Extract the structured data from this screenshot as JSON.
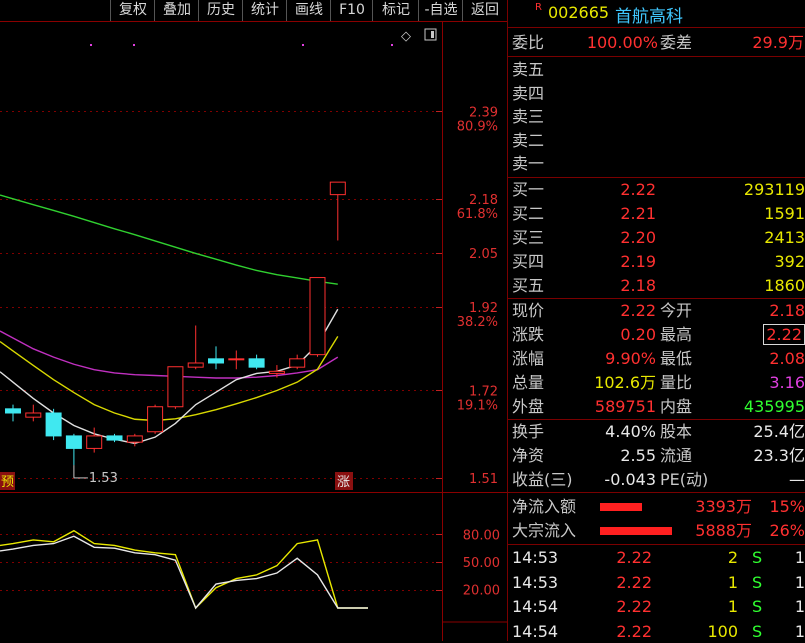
{
  "toolbar": {
    "buttons": [
      "复权",
      "叠加",
      "历史",
      "统计",
      "画线",
      "F10",
      "标记",
      "-自选",
      "返回"
    ]
  },
  "stock": {
    "badge": "R",
    "code": "002665",
    "name": "首航高科"
  },
  "chart_data": {
    "type": "candlestick",
    "y_ticks": [
      {
        "price": "2.39",
        "pct": "80.9%"
      },
      {
        "price": "2.18",
        "pct": "61.8%"
      },
      {
        "price": "2.05",
        "pct": ""
      },
      {
        "price": "1.92",
        "pct": "38.2%"
      },
      {
        "price": "1.72",
        "pct": "19.1%"
      },
      {
        "price": "1.51",
        "pct": ""
      }
    ],
    "low_annotation": "1.53",
    "badge_left": "预",
    "badge_right": "涨",
    "candles": [
      {
        "open": 1.676,
        "close": 1.666,
        "high": 1.686,
        "low": 1.646
      },
      {
        "open": 1.656,
        "close": 1.666,
        "high": 1.686,
        "low": 1.646
      },
      {
        "open": 1.666,
        "close": 1.611,
        "high": 1.676,
        "low": 1.601
      },
      {
        "open": 1.611,
        "close": 1.581,
        "high": 1.616,
        "low": 1.541
      },
      {
        "open": 1.581,
        "close": 1.611,
        "high": 1.631,
        "low": 1.571
      },
      {
        "open": 1.611,
        "close": 1.601,
        "high": 1.616,
        "low": 1.596
      },
      {
        "open": 1.596,
        "close": 1.611,
        "high": 1.616,
        "low": 1.586
      },
      {
        "open": 1.621,
        "close": 1.681,
        "high": 1.686,
        "low": 1.616
      },
      {
        "open": 1.681,
        "close": 1.777,
        "high": 1.777,
        "low": 1.676
      },
      {
        "open": 1.776,
        "close": 1.786,
        "high": 1.876,
        "low": 1.771
      },
      {
        "open": 1.796,
        "close": 1.786,
        "high": 1.826,
        "low": 1.771
      },
      {
        "open": 1.796,
        "close": 1.796,
        "high": 1.816,
        "low": 1.771
      },
      {
        "open": 1.796,
        "close": 1.776,
        "high": 1.806,
        "low": 1.771
      },
      {
        "open": 1.761,
        "close": 1.766,
        "high": 1.781,
        "low": 1.751
      },
      {
        "open": 1.776,
        "close": 1.796,
        "high": 1.806,
        "low": 1.771
      },
      {
        "open": 1.806,
        "close": 1.991,
        "high": 1.991,
        "low": 1.801
      },
      {
        "open": 2.19,
        "close": 2.22,
        "high": 2.22,
        "low": 2.08
      }
    ],
    "ma_green": [
      2.18,
      2.166,
      2.152,
      2.138,
      2.123,
      2.108,
      2.094,
      2.079,
      2.064,
      2.049,
      2.035,
      2.021,
      2.008,
      1.998,
      1.99,
      1.982,
      1.975
    ],
    "ma_white": [
      1.74,
      1.701,
      1.666,
      1.636,
      1.616,
      1.603,
      1.593,
      1.608,
      1.641,
      1.686,
      1.716,
      1.746,
      1.761,
      1.766,
      1.781,
      1.83,
      1.915
    ],
    "ma_yellow": [
      1.815,
      1.78,
      1.746,
      1.715,
      1.686,
      1.666,
      1.651,
      1.648,
      1.652,
      1.662,
      1.674,
      1.688,
      1.703,
      1.72,
      1.74,
      1.771,
      1.85
    ],
    "ma_magenta": [
      1.846,
      1.82,
      1.8,
      1.783,
      1.77,
      1.762,
      1.758,
      1.756,
      1.754,
      1.752,
      1.75,
      1.75,
      1.752,
      1.756,
      1.762,
      1.77,
      1.8
    ],
    "indicator": {
      "y_ticks": [
        "80.00",
        "50.00",
        "20.00"
      ],
      "ylim": [
        0,
        100
      ],
      "white": [
        64,
        68,
        70,
        78,
        66,
        65,
        60,
        58,
        52,
        0,
        26,
        30,
        32,
        38,
        54,
        36,
        0
      ],
      "yellow": [
        70,
        74,
        72,
        84,
        70,
        68,
        63,
        60,
        58,
        0,
        22,
        32,
        36,
        46,
        70,
        74,
        0
      ]
    }
  },
  "order_book": {
    "weibi_label": "委比",
    "weibi_value": "100.00%",
    "weicha_label": "委差",
    "weicha_value": "29.9万",
    "asks": [
      {
        "label": "卖五"
      },
      {
        "label": "卖四"
      },
      {
        "label": "卖三"
      },
      {
        "label": "卖二"
      },
      {
        "label": "卖一"
      }
    ],
    "bids": [
      {
        "label": "买一",
        "price": "2.22",
        "vol": "293119"
      },
      {
        "label": "买二",
        "price": "2.21",
        "vol": "1591"
      },
      {
        "label": "买三",
        "price": "2.20",
        "vol": "2413"
      },
      {
        "label": "买四",
        "price": "2.19",
        "vol": "392"
      },
      {
        "label": "买五",
        "price": "2.18",
        "vol": "1860"
      }
    ]
  },
  "quote": {
    "rows": [
      {
        "l1": "现价",
        "v1": "2.22",
        "l2": "今开",
        "v2": "2.18",
        "c1": "red",
        "c2": "red"
      },
      {
        "l1": "涨跌",
        "v1": "0.20",
        "l2": "最高",
        "v2": "2.22",
        "c1": "red",
        "c2": "red"
      },
      {
        "l1": "涨幅",
        "v1": "9.90%",
        "l2": "最低",
        "v2": "2.08",
        "c1": "red",
        "c2": "red"
      },
      {
        "l1": "总量",
        "v1": "102.6万",
        "l2": "量比",
        "v2": "3.16",
        "c1": "yel",
        "c2": "mag"
      },
      {
        "l1": "外盘",
        "v1": "589751",
        "l2": "内盘",
        "v2": "435995",
        "c1": "red",
        "c2": "grn"
      }
    ]
  },
  "fundamentals": {
    "rows": [
      {
        "l1": "换手",
        "v1": "4.40%",
        "l2": "股本",
        "v2": "25.4亿"
      },
      {
        "l1": "净资",
        "v1": "2.55",
        "l2": "流通",
        "v2": "23.3亿"
      },
      {
        "l1": "收益(三)",
        "v1": "-0.043",
        "l2": "PE(动)",
        "v2": "—"
      }
    ]
  },
  "flow": {
    "rows": [
      {
        "label": "净流入额",
        "amount": "3393万",
        "pct": "15%",
        "bar": 0.58
      },
      {
        "label": "大宗流入",
        "amount": "5888万",
        "pct": "26%",
        "bar": 1.0
      }
    ]
  },
  "ticks": [
    {
      "time": "14:53",
      "price": "2.22",
      "vol": "2",
      "side": "S",
      "count": "1"
    },
    {
      "time": "14:53",
      "price": "2.22",
      "vol": "1",
      "side": "S",
      "count": "1"
    },
    {
      "time": "14:54",
      "price": "2.22",
      "vol": "1",
      "side": "S",
      "count": "1"
    },
    {
      "time": "14:54",
      "price": "2.22",
      "vol": "100",
      "side": "S",
      "count": "1"
    }
  ]
}
